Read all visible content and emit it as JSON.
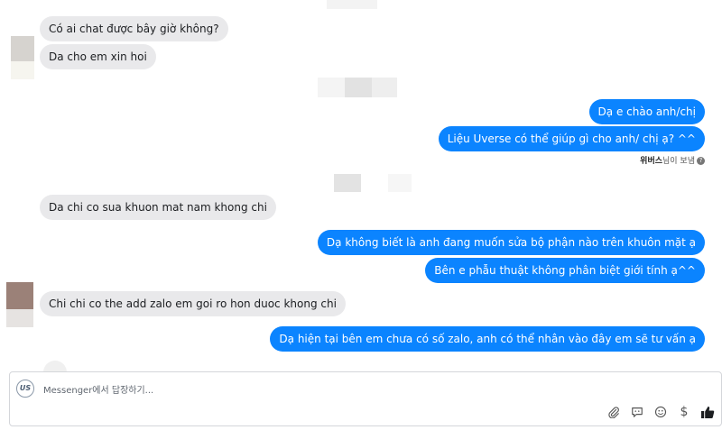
{
  "conversation": {
    "incoming_1": {
      "text_1": "Có ai chat được bây giờ không?",
      "text_2": "Da cho em xin hoi"
    },
    "outgoing_1": {
      "text_1": "Dạ e chào anh/chị",
      "text_2": "Liệu Uverse có thể giúp gì cho anh/ chị ạ? ^^",
      "seen_name": "위버스",
      "seen_suffix": "님이 보냄"
    },
    "incoming_2": {
      "text_1": "Da chi co sua khuon mat nam khong chi"
    },
    "outgoing_2": {
      "text_1": "Dạ không biết là anh đang muốn sửa bộ phận nào trên khuôn mặt ạ",
      "text_2": "Bên e phẫu thuật không phân biệt giới tính ạ^^"
    },
    "incoming_3": {
      "text_1": "Chi chi co the add zalo em goi ro hon duoc khong chi"
    },
    "outgoing_3": {
      "text_1": "Dạ hiện tại bên em chưa có số zalo, anh có thể nhân vào đây em sẽ tư vấn ạ"
    }
  },
  "composer": {
    "logo_text": "US",
    "placeholder": "Messenger에서 답장하기..."
  },
  "toolbar": {
    "icons": [
      "paperclip-icon",
      "sticker-icon",
      "emoji-icon",
      "dollar-icon",
      "thumbs-up-icon"
    ],
    "dollar_glyph": "$"
  },
  "colors": {
    "outgoing_bubble": "#0b84ff",
    "incoming_bubble": "#e9e9eb",
    "like_button": "#1c1e21"
  }
}
